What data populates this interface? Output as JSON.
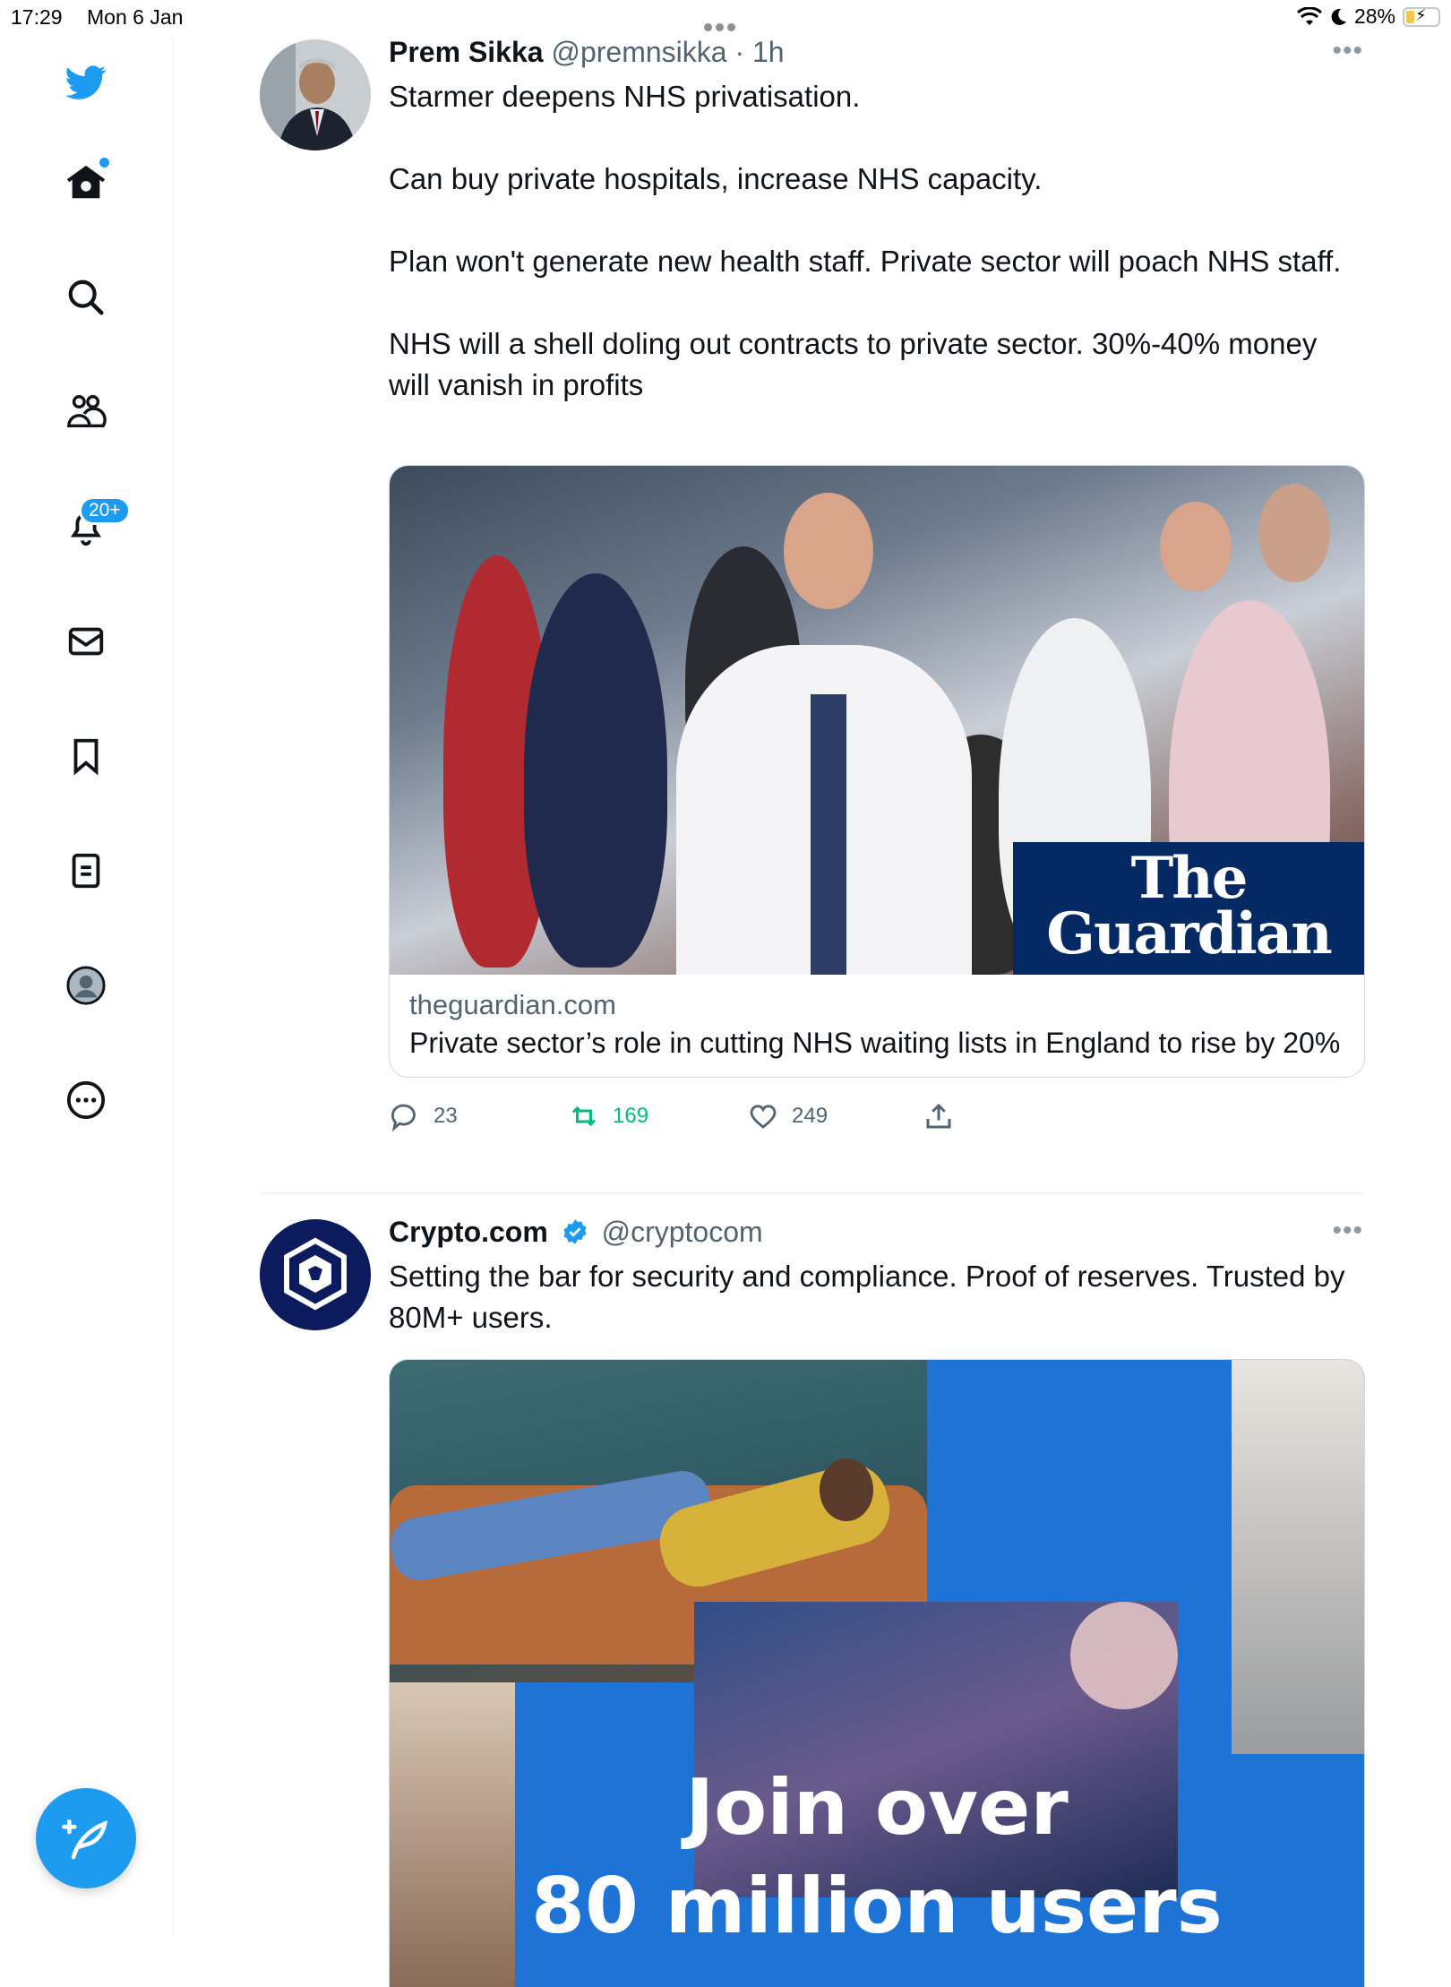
{
  "status": {
    "time": "17:29",
    "date": "Mon 6 Jan",
    "battery": "28%"
  },
  "sidebar": {
    "notification_badge": "20+"
  },
  "tweets": [
    {
      "name": "Prem Sikka",
      "handle": "@premnsikka",
      "separator": "·",
      "time": "1h",
      "paragraphs": [
        "Starmer deepens NHS privatisation.",
        "Can buy private hospitals, increase NHS capacity.",
        "Plan won't generate new health staff. Private sector will poach NHS staff.",
        "NHS will a shell doling out contracts to private sector. 30%-40% money will vanish in profits"
      ],
      "card": {
        "logo_line1": "The",
        "logo_line2": "Guardian",
        "domain": "theguardian.com",
        "title": "Private sector’s role in cutting NHS waiting lists in England to rise by 20%"
      },
      "actions": {
        "replies": "23",
        "retweets": "169",
        "likes": "249"
      }
    },
    {
      "name": "Crypto.com",
      "handle": "@cryptocom",
      "text": "Setting the bar for security and compliance. Proof of reserves. Trusted by 80M+ users.",
      "media": {
        "line1": "Join over",
        "line2": "80 million users"
      }
    }
  ],
  "colors": {
    "accent": "#1d9bf0",
    "retweet_green": "#00ba7c",
    "guardian_navy": "#052962"
  }
}
